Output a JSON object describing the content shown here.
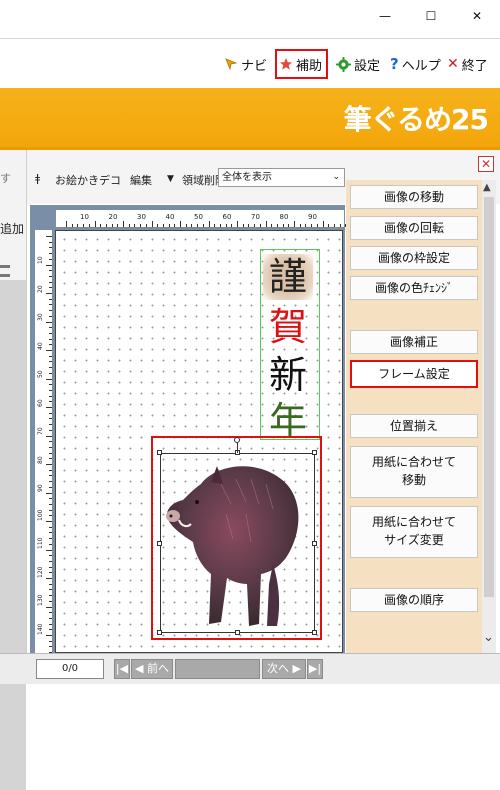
{
  "window": {
    "minimize_glyph": "—",
    "maximize_glyph": "☐",
    "close_glyph": "✕"
  },
  "menu": {
    "navi": "ナビ",
    "hojo": "補助",
    "settei": "設定",
    "help": "ヘルプ",
    "end": "終了"
  },
  "brand": "筆ぐるめ25",
  "left_pane": {
    "partial_top": "す",
    "partial_add": "追加"
  },
  "toolbar": {
    "pin_glyph": "ǂ",
    "deco": "お絵かきデコ",
    "edit": "編集",
    "edit_arrow": "▼",
    "area_delete": "領域削除",
    "zoom_value": "全体を表示",
    "zoom_arrow": "⌄",
    "close_glyph": "✕"
  },
  "ruler": {
    "h_labels": [
      "10",
      "20",
      "30",
      "40",
      "50",
      "60",
      "70",
      "80",
      "90"
    ],
    "v_labels": [
      "10",
      "20",
      "30",
      "40",
      "50",
      "60",
      "70",
      "80",
      "90",
      "100",
      "110",
      "120",
      "130",
      "140"
    ]
  },
  "card_text": [
    "謹",
    "賀",
    "新",
    "年"
  ],
  "right_panel": {
    "move": "画像の移動",
    "rotate": "画像の回転",
    "frame": "画像の枠設定",
    "color": "画像の色ﾁｪﾝｼﾞ",
    "correct": "画像補正",
    "frame_setting": "フレーム設定",
    "align": "位置揃え",
    "fit_move_l1": "用紙に合わせて",
    "fit_move_l2": "移動",
    "fit_resize_l1": "用紙に合わせて",
    "fit_resize_l2": "サイズ変更",
    "order": "画像の順序",
    "scroll_up": "▲",
    "scroll_down": "⌄"
  },
  "bottom": {
    "page": "0/0",
    "first": "|◀",
    "prev": "◀ 前へ",
    "next": "次へ ▶",
    "last": "▶|"
  },
  "colors": {
    "banner": "#f3a60c",
    "highlight": "#e01010",
    "panel": "#f5e1c2"
  }
}
